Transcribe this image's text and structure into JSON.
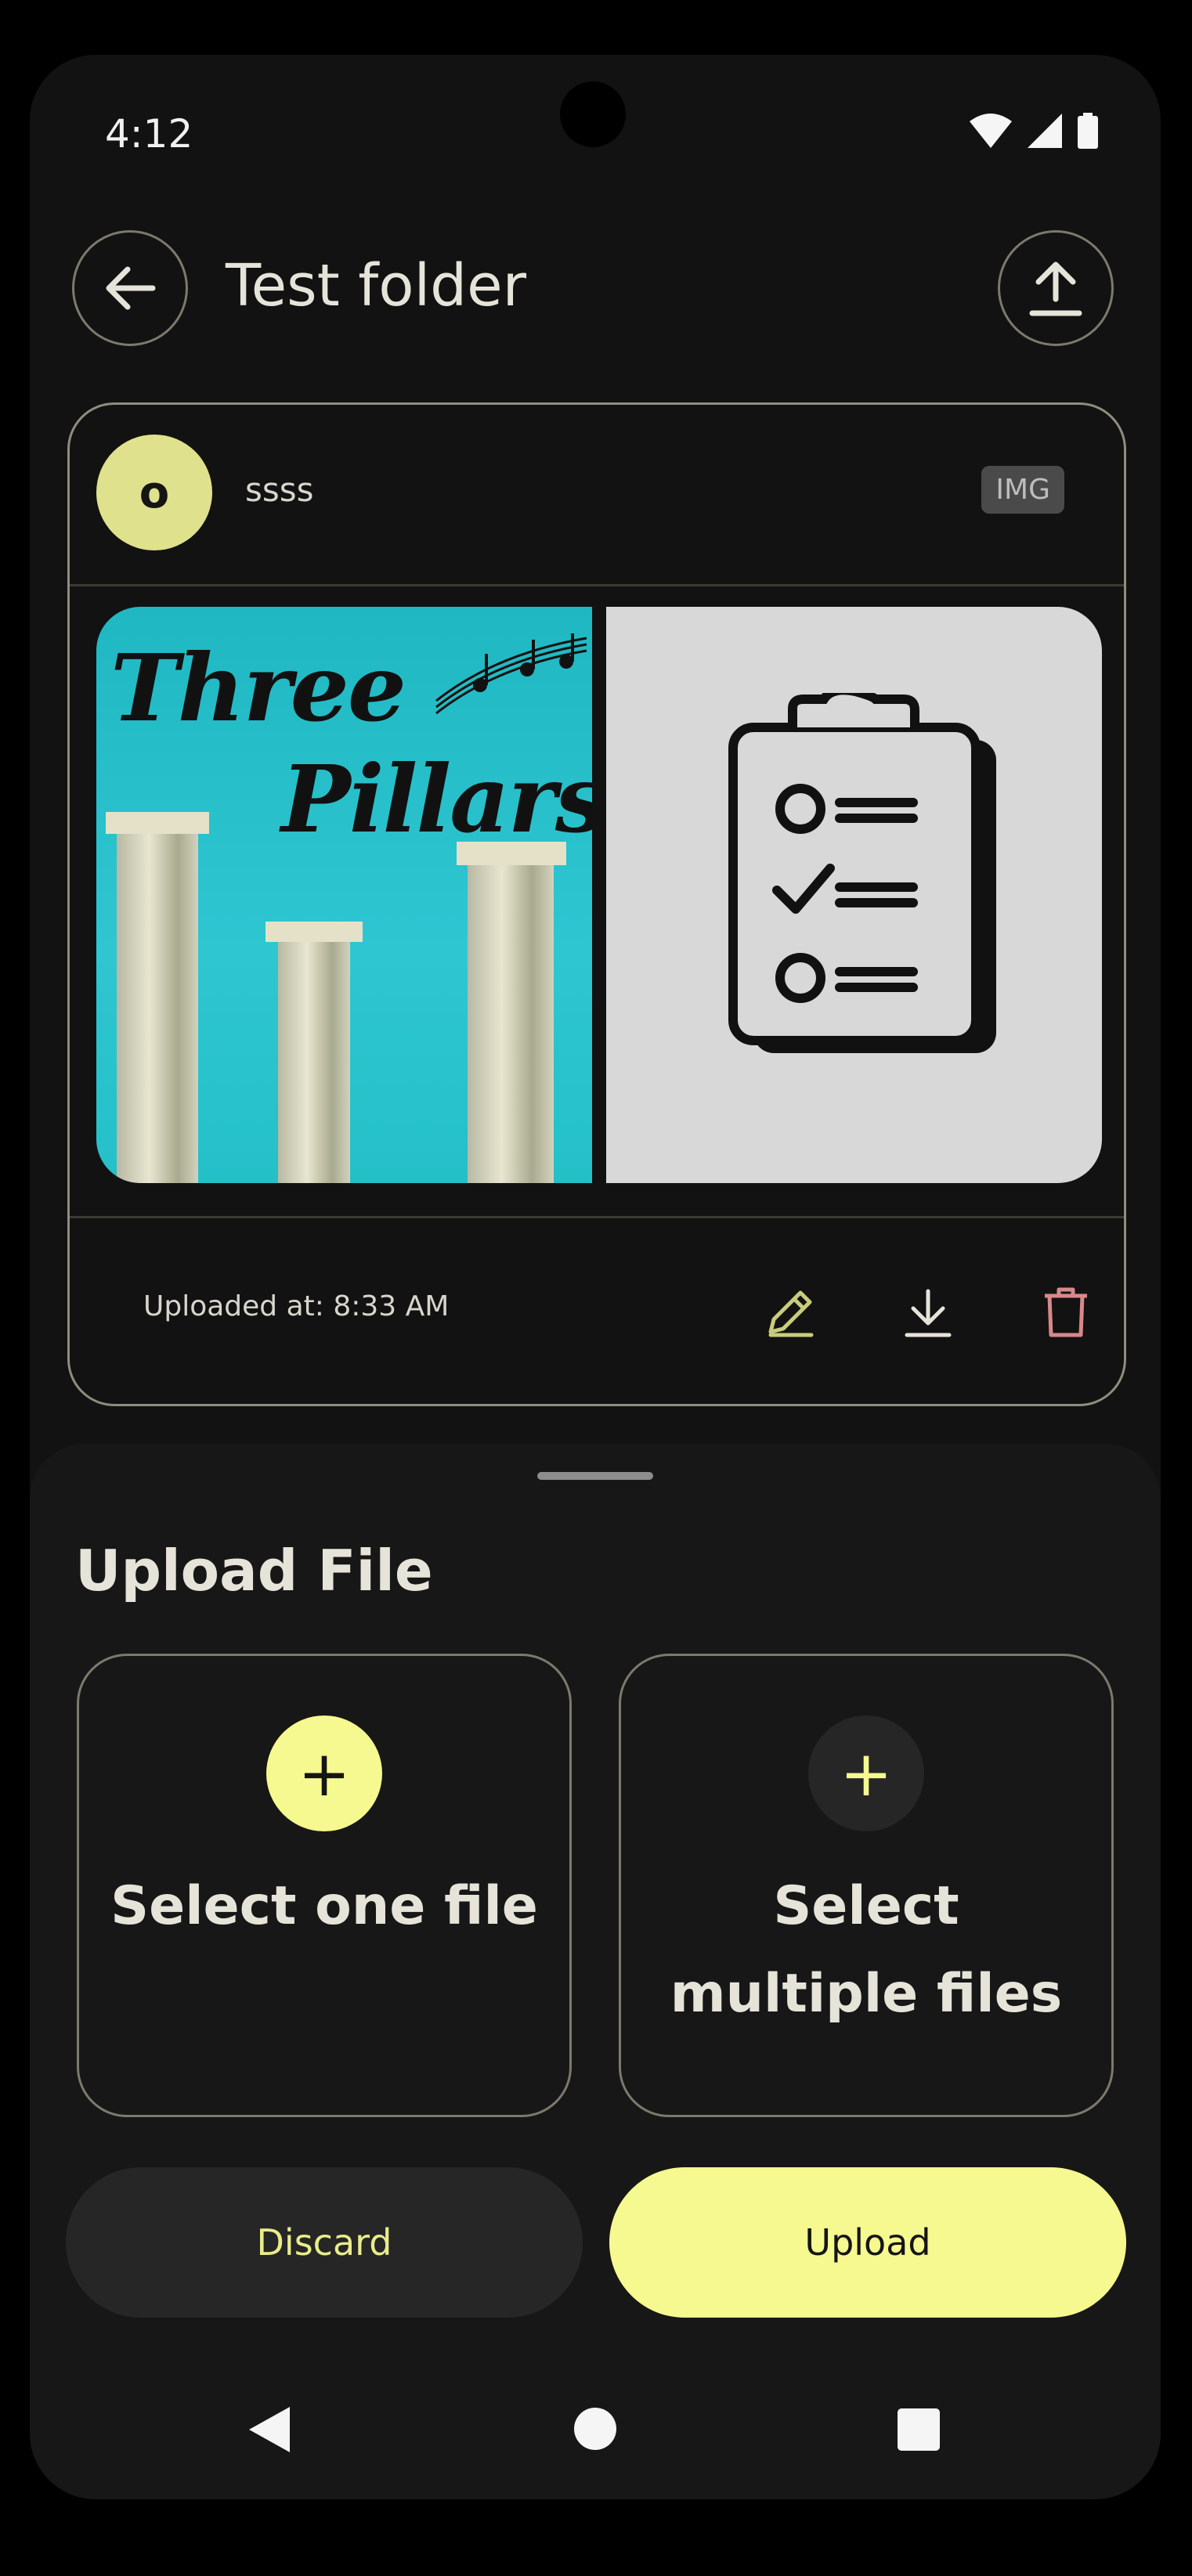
{
  "status_bar": {
    "time": "4:12"
  },
  "header": {
    "title": "Test folder"
  },
  "file_card": {
    "avatar_letter": "o",
    "owner": "ssss",
    "type_badge": "IMG",
    "uploaded_at": "Uploaded at: 8:33 AM",
    "thumbnails": [
      {
        "text_line1": "Three",
        "text_line2": "Pillars",
        "icon": "pillars-image"
      },
      {
        "icon": "clipboard-checklist-icon"
      }
    ]
  },
  "sheet": {
    "title": "Upload File",
    "select_one_label": "Select one file",
    "select_multiple_label": "Select multiple files",
    "discard_label": "Discard",
    "upload_label": "Upload"
  },
  "colors": {
    "accent": "#f6f98f",
    "edit": "#c9cc7a",
    "delete": "#d9888a",
    "background": "#121212"
  }
}
